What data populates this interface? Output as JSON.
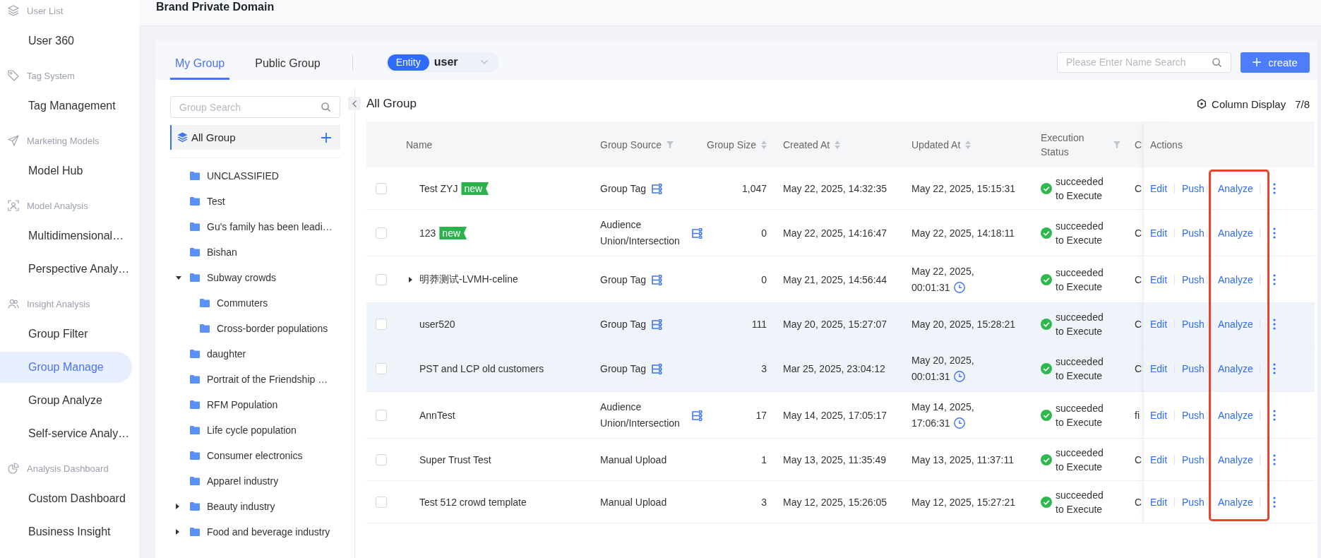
{
  "sidebar": {
    "sections": [
      {
        "title": "User List",
        "items": [
          {
            "label": "User 360",
            "selected": false
          }
        ]
      },
      {
        "title": "Tag System",
        "items": [
          {
            "label": "Tag Management",
            "selected": false
          }
        ]
      },
      {
        "title": "Marketing Models",
        "items": [
          {
            "label": "Model Hub",
            "selected": false
          }
        ]
      },
      {
        "title": "Model Analysis",
        "items": [
          {
            "label": "Multidimensional…",
            "selected": false
          },
          {
            "label": "Perspective Analy…",
            "selected": false
          }
        ]
      },
      {
        "title": "Insight Analysis",
        "items": [
          {
            "label": "Group Filter",
            "selected": false
          },
          {
            "label": "Group Manage",
            "selected": true
          },
          {
            "label": "Group Analyze",
            "selected": false
          },
          {
            "label": "Self-service Analy…",
            "selected": false
          }
        ]
      },
      {
        "title": "Analysis Dashboard",
        "items": [
          {
            "label": "Custom Dashboard",
            "selected": false
          },
          {
            "label": "Business Insight",
            "selected": false
          }
        ]
      }
    ]
  },
  "header": {
    "title": "Brand Private Domain"
  },
  "toolbar": {
    "tabs": [
      {
        "label": "My Group",
        "selected": true
      },
      {
        "label": "Public Group",
        "selected": false
      }
    ],
    "entity": {
      "label": "Entity",
      "value": "user"
    },
    "search": {
      "placeholder": "Please Enter Name Search"
    },
    "create_button": {
      "label": "create"
    }
  },
  "tree": {
    "search": {
      "placeholder": "Group Search"
    },
    "root": {
      "label": "All Group",
      "selected": true
    },
    "items": [
      {
        "label": "UNCLASSIFIED",
        "selected": false
      },
      {
        "label": "Test",
        "selected": false
      },
      {
        "label": "Gu's family has been leadi…",
        "selected": false
      },
      {
        "label": "Bishan",
        "selected": false
      },
      {
        "label": "Subway crowds",
        "selected": false,
        "expanded": true,
        "children": [
          {
            "label": "Commuters",
            "selected": false
          },
          {
            "label": "Cross-border populations",
            "selected": false
          }
        ]
      },
      {
        "label": "daughter",
        "selected": false
      },
      {
        "label": "Portrait of the Friendship …",
        "selected": false
      },
      {
        "label": "RFM Population",
        "selected": false
      },
      {
        "label": "Life cycle population",
        "selected": false
      },
      {
        "label": "Consumer electronics",
        "selected": false
      },
      {
        "label": "Apparel industry",
        "selected": false
      },
      {
        "label": "Beauty industry",
        "selected": false,
        "expanded": false
      },
      {
        "label": "Food and beverage industry",
        "selected": false,
        "expanded": false
      }
    ]
  },
  "content": {
    "title": "All Group",
    "column_display": {
      "label": "Column Display",
      "count": "7/8"
    }
  },
  "table": {
    "columns": [
      {
        "label": "Name",
        "kind": "plain"
      },
      {
        "label": "Group Source",
        "kind": "filter"
      },
      {
        "label": "Group Size",
        "kind": "sort"
      },
      {
        "label": "Created At",
        "kind": "sort"
      },
      {
        "label": "Updated At",
        "kind": "sort"
      },
      {
        "label": "Execution Status",
        "kind": "filter"
      },
      {
        "label": "C",
        "kind": "plain"
      },
      {
        "label": "Actions",
        "kind": "plain"
      }
    ],
    "annotation": {
      "kind": "frame"
    },
    "rows": [
      {
        "checked": false,
        "highlighted": false,
        "name": "Test ZYJ",
        "badge": "new",
        "source": {
          "text": "Group Tag",
          "linked": true
        },
        "size": "1,047",
        "created": "May 22, 2025, 14:32:35",
        "updated": {
          "text": "May 22, 2025, 15:15:31",
          "scheduled": false
        },
        "status": {
          "kind": "success",
          "text": "succeeded to Execute"
        },
        "column_7": "C",
        "actions": [
          "Edit",
          "Push",
          "Analyze"
        ]
      },
      {
        "checked": false,
        "highlighted": false,
        "name": "123",
        "badge": "new",
        "source": {
          "text": "Audience Union/Intersection",
          "linked": true
        },
        "size": "0",
        "created": "May 22, 2025, 14:16:47",
        "updated": {
          "text": "May 22, 2025, 14:18:11",
          "scheduled": false
        },
        "status": {
          "kind": "success",
          "text": "succeeded to Execute"
        },
        "column_7": "C",
        "actions": [
          "Edit",
          "Push",
          "Analyze"
        ]
      },
      {
        "checked": false,
        "highlighted": false,
        "name": "明莽测试-LVMH-celine",
        "expanded": false,
        "source": {
          "text": "Group Tag",
          "linked": true
        },
        "size": "0",
        "created": "May 21, 2025, 14:56:44",
        "updated": {
          "text": "May 22, 2025, 00:01:31",
          "scheduled": true
        },
        "status": {
          "kind": "success",
          "text": "succeeded to Execute"
        },
        "column_7": "C",
        "actions": [
          "Edit",
          "Push",
          "Analyze"
        ]
      },
      {
        "checked": false,
        "highlighted": true,
        "name": "user520",
        "source": {
          "text": "Group Tag",
          "linked": true
        },
        "size": "111",
        "created": "May 20, 2025, 15:27:07",
        "updated": {
          "text": "May 20, 2025, 15:28:21",
          "scheduled": false
        },
        "status": {
          "kind": "success",
          "text": "succeeded to Execute"
        },
        "column_7": "C",
        "actions": [
          "Edit",
          "Push",
          "Analyze"
        ]
      },
      {
        "checked": false,
        "highlighted": true,
        "name": "PST and LCP old customers",
        "source": {
          "text": "Group Tag",
          "linked": true
        },
        "size": "3",
        "created": "Mar 25, 2025, 23:04:12",
        "updated": {
          "text": "May 20, 2025, 00:01:31",
          "scheduled": true
        },
        "status": {
          "kind": "success",
          "text": "succeeded to Execute"
        },
        "column_7": "C",
        "actions": [
          "Edit",
          "Push",
          "Analyze"
        ]
      },
      {
        "checked": false,
        "highlighted": false,
        "name": "AnnTest",
        "source": {
          "text": "Audience Union/Intersection",
          "linked": true
        },
        "size": "17",
        "created": "May 14, 2025, 17:05:17",
        "updated": {
          "text": "May 14, 2025, 17:06:31",
          "scheduled": true
        },
        "status": {
          "kind": "success",
          "text": "succeeded to Execute"
        },
        "column_7": "fi",
        "actions": [
          "Edit",
          "Push",
          "Analyze"
        ]
      },
      {
        "checked": false,
        "highlighted": false,
        "name": "Super Trust Test",
        "source": {
          "text": "Manual Upload",
          "linked": false
        },
        "size": "1",
        "created": "May 13, 2025, 11:35:49",
        "updated": {
          "text": "May 13, 2025, 11:37:11",
          "scheduled": false
        },
        "status": {
          "kind": "success",
          "text": "succeeded to Execute"
        },
        "column_7": "C",
        "actions": [
          "Edit",
          "Push",
          "Analyze"
        ]
      },
      {
        "checked": false,
        "highlighted": false,
        "name": "Test 512 crowd template",
        "source": {
          "text": "Manual Upload",
          "linked": false
        },
        "size": "3",
        "created": "May 12, 2025, 15:26:05",
        "updated": {
          "text": "May 12, 2025, 15:27:21",
          "scheduled": false
        },
        "status": {
          "kind": "success",
          "text": "succeeded to Execute"
        },
        "column_7": "C",
        "actions": [
          "Edit",
          "Push",
          "Analyze"
        ]
      }
    ]
  }
}
